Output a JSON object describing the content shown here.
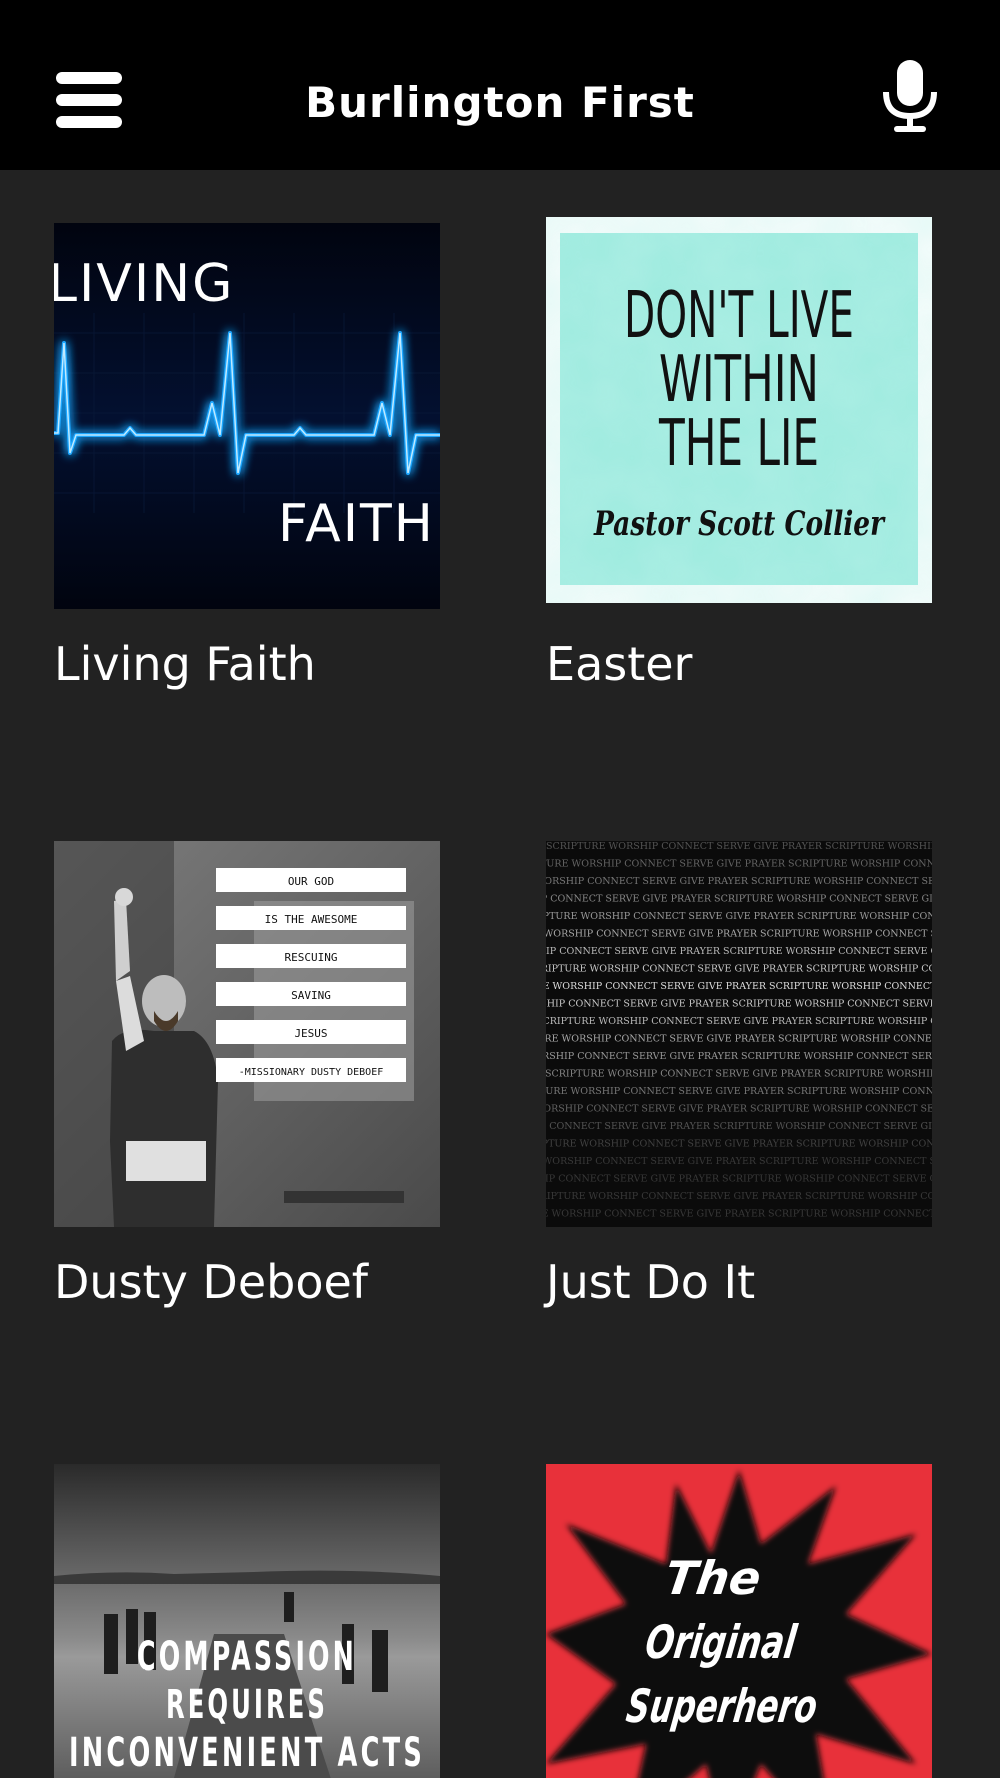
{
  "header": {
    "title": "Burlington First",
    "menu_icon": "hamburger-menu-icon",
    "mic_icon": "microphone-icon"
  },
  "colors": {
    "header_bg": "#000000",
    "page_bg": "#222222",
    "text": "#ffffff",
    "accent_red": "#e8313a",
    "accent_aqua": "#8fe6d8",
    "glow_blue": "#1fa7ff"
  },
  "series": [
    {
      "title": "Living Faith",
      "art": {
        "top_word": "LIVING",
        "bottom_word": "FAITH"
      }
    },
    {
      "title": "Easter",
      "art": {
        "lines": [
          "DON'T LIVE",
          "WITHIN",
          "THE LIE"
        ],
        "byline": "Pastor Scott Collier"
      }
    },
    {
      "title": "Dusty Deboef",
      "art": {
        "labels": [
          "OUR GOD",
          "IS THE AWESOME",
          "RESCUING",
          "SAVING",
          "JESUS",
          "-MISSIONARY DUSTY DEBOEF"
        ]
      }
    },
    {
      "title": "Just Do It",
      "art": {
        "pattern_text": "SCRIPTURE WORSHIP CONNECT SERVE GIVE PRAYER"
      }
    },
    {
      "title": "",
      "art": {
        "lines": [
          "COMPASSION",
          "REQUIRES",
          "INCONVENIENT ACTS"
        ]
      }
    },
    {
      "title": "",
      "art": {
        "lines": [
          "The",
          "Original",
          "Superhero"
        ]
      }
    }
  ]
}
